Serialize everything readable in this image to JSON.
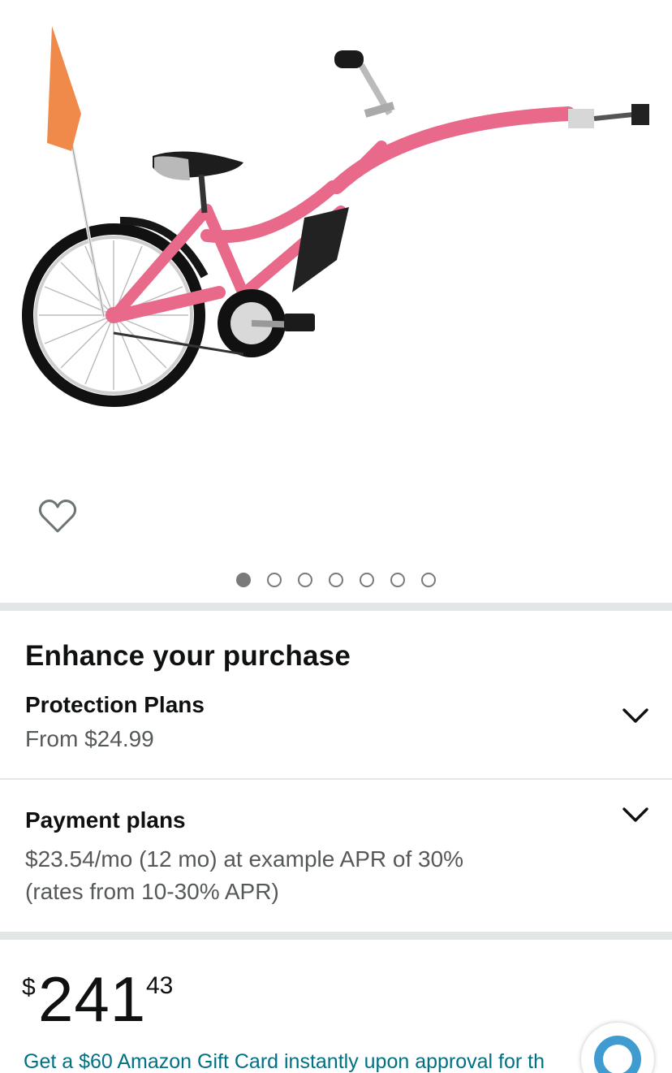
{
  "product": {
    "image_alt": "pink tag-along trailer bike",
    "image_count": 7,
    "active_image_index": 0,
    "colors": {
      "frame": "#e8698a",
      "flag": "#f08a4b"
    }
  },
  "wishlist": {
    "icon": "heart-outline-icon"
  },
  "enhance": {
    "title": "Enhance your purchase",
    "protection": {
      "title": "Protection Plans",
      "subtitle": "From $24.99",
      "icon": "chevron-down-icon"
    },
    "payment": {
      "title": "Payment plans",
      "line1": "$23.54/mo (12 mo) at example APR of 30%",
      "line2": "(rates from 10-30% APR)",
      "icon": "chevron-down-icon"
    }
  },
  "price": {
    "symbol": "$",
    "whole": "241",
    "fraction": "43"
  },
  "promo": {
    "text": "Get a $60 Amazon Gift Card instantly upon approval for th",
    "color": "#007185"
  },
  "assistant": {
    "icon": "alexa-ring-icon",
    "color": "#3f9bd0"
  }
}
